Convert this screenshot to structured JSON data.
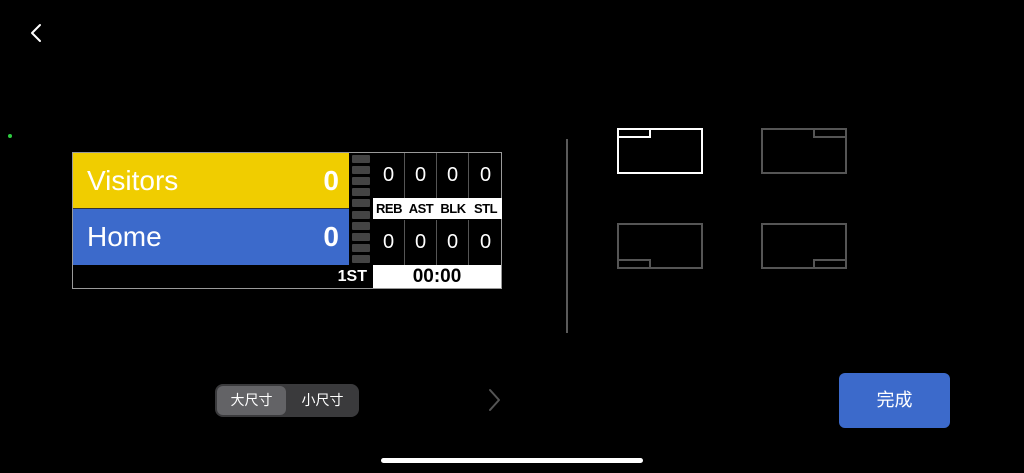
{
  "nav": {
    "back_icon": "chevron-left-icon"
  },
  "scoreboard": {
    "visitors": {
      "name": "Visitors",
      "score": "0",
      "color": "#f0cd00"
    },
    "home": {
      "name": "Home",
      "score": "0",
      "color": "#3c6acb"
    },
    "stat_labels": [
      "REB",
      "AST",
      "BLK",
      "STL"
    ],
    "visitors_stats": [
      "0",
      "0",
      "0",
      "0"
    ],
    "home_stats": [
      "0",
      "0",
      "0",
      "0"
    ],
    "period": "1ST",
    "clock": "00:00"
  },
  "layouts": [
    {
      "name": "top-left",
      "selected": true
    },
    {
      "name": "top-right",
      "selected": false
    },
    {
      "name": "bottom-left",
      "selected": false
    },
    {
      "name": "bottom-right",
      "selected": false
    }
  ],
  "size_toggle": {
    "large": "大尺寸",
    "small": "小尺寸",
    "selected": "large"
  },
  "next_icon": "chevron-right-icon",
  "done_button": {
    "label": "完成",
    "color": "#3c6acb"
  }
}
